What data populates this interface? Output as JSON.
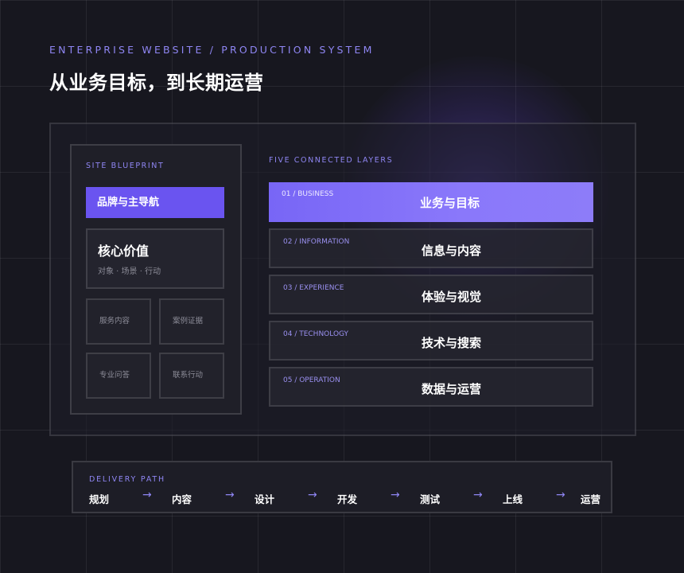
{
  "header": {
    "eyebrow": "ENTERPRISE WEBSITE / PRODUCTION SYSTEM",
    "title": "从业务目标，到长期运营"
  },
  "blueprint": {
    "label": "SITE BLUEPRINT",
    "nav": "品牌与主导航",
    "core_title": "核心价值",
    "core_subtitle": "对象 · 场景 · 行动",
    "cells": [
      "服务内容",
      "案例证据",
      "专业问答",
      "联系行动"
    ]
  },
  "layers": {
    "label": "FIVE CONNECTED LAYERS",
    "items": [
      {
        "code": "01 / BUSINESS",
        "name": "业务与目标",
        "active": true
      },
      {
        "code": "02 / INFORMATION",
        "name": "信息与内容",
        "active": false
      },
      {
        "code": "03 / EXPERIENCE",
        "name": "体验与视觉",
        "active": false
      },
      {
        "code": "04 / TECHNOLOGY",
        "name": "技术与搜索",
        "active": false
      },
      {
        "code": "05 / OPERATION",
        "name": "数据与运营",
        "active": false
      }
    ]
  },
  "delivery": {
    "label": "DELIVERY PATH",
    "steps": [
      "规划",
      "内容",
      "设计",
      "开发",
      "测试",
      "上线",
      "运营"
    ],
    "arrow": "→"
  },
  "colors": {
    "background": "#17171f",
    "accent": "#6a54f0",
    "accent_text": "#8f86f3"
  }
}
